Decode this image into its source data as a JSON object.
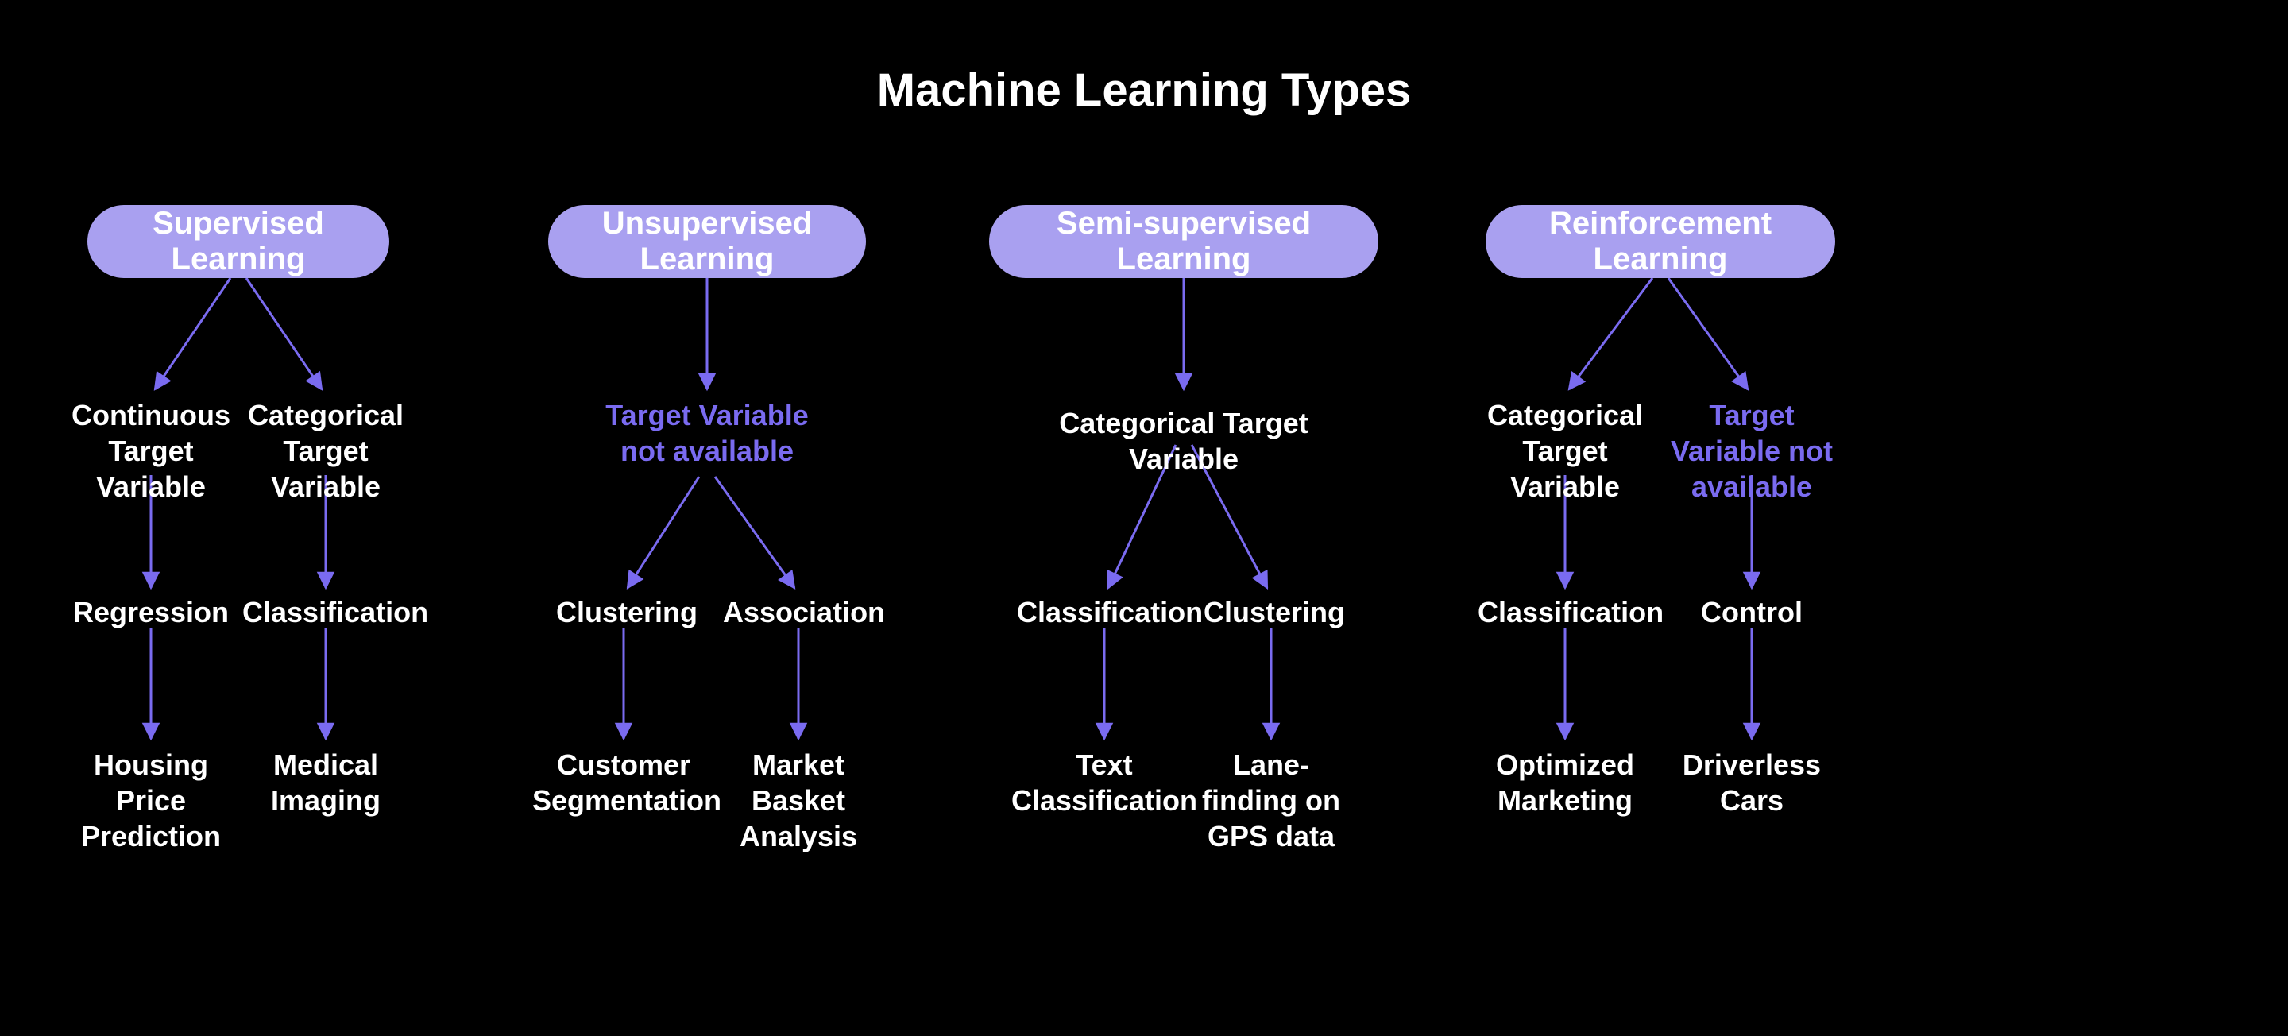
{
  "title": "Machine Learning Types",
  "colors": {
    "background": "#000000",
    "pill": "#a9a0f0",
    "accent": "#7a6bf0",
    "text": "#ffffff"
  },
  "pills": {
    "supervised": "Supervised Learning",
    "unsupervised": "Unsupervised Learning",
    "semisupervised": "Semi-supervised Learning",
    "reinforcement": "Reinforcement Learning"
  },
  "supervised": {
    "left": {
      "target": "Continuous Target Variable",
      "method": "Regression",
      "example": "Housing Price Prediction"
    },
    "right": {
      "target": "Categorical Target Variable",
      "method": "Classification",
      "example": "Medical Imaging"
    }
  },
  "unsupervised": {
    "target": "Target Variable not available",
    "left": {
      "method": "Clustering",
      "example": "Customer Segmentation"
    },
    "right": {
      "method": "Association",
      "example": "Market Basket Analysis"
    }
  },
  "semisupervised": {
    "target": "Categorical Target Variable",
    "left": {
      "method": "Classification",
      "example": "Text Classification"
    },
    "right": {
      "method": "Clustering",
      "example": "Lane-finding on GPS data"
    }
  },
  "reinforcement": {
    "left": {
      "target": "Categorical Target Variable",
      "method": "Classification",
      "example": "Optimized Marketing"
    },
    "right": {
      "target": "Target Variable not available",
      "method": "Control",
      "example": "Driverless Cars"
    }
  }
}
